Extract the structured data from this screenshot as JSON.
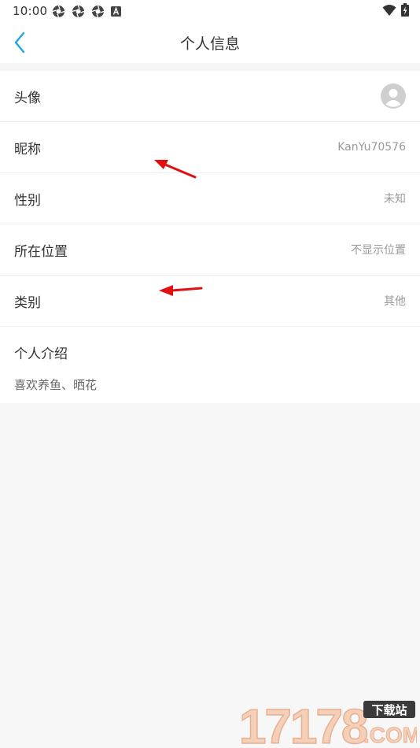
{
  "status_bar": {
    "time": "10:00",
    "notification_icons": [
      "aperture-icon",
      "aperture-icon",
      "aperture-icon",
      "a-box-icon"
    ],
    "right_icons": [
      "wifi-icon",
      "battery-charging-icon"
    ]
  },
  "header": {
    "title": "个人信息",
    "back_icon": "chevron-left-icon",
    "accent_color": "#1aa9e6"
  },
  "profile": {
    "rows": [
      {
        "label": "头像",
        "value": "",
        "icon": "avatar-placeholder-icon"
      },
      {
        "label": "昵称",
        "value": "KanYu70576"
      },
      {
        "label": "性别",
        "value": "未知"
      },
      {
        "label": "所在位置",
        "value": "不显示位置"
      },
      {
        "label": "类别",
        "value": "其他"
      }
    ],
    "intro": {
      "label": "个人介绍",
      "text": "喜欢养鱼、晒花"
    }
  },
  "annotations": {
    "arrow_color": "#e01010"
  },
  "watermark": {
    "number": "17178",
    "tag": "下载站",
    "domain": ".COM"
  },
  "colors": {
    "background": "#f7f7f7",
    "row_background": "#ffffff",
    "label_text": "#333333",
    "value_text": "#9a9a9a"
  }
}
